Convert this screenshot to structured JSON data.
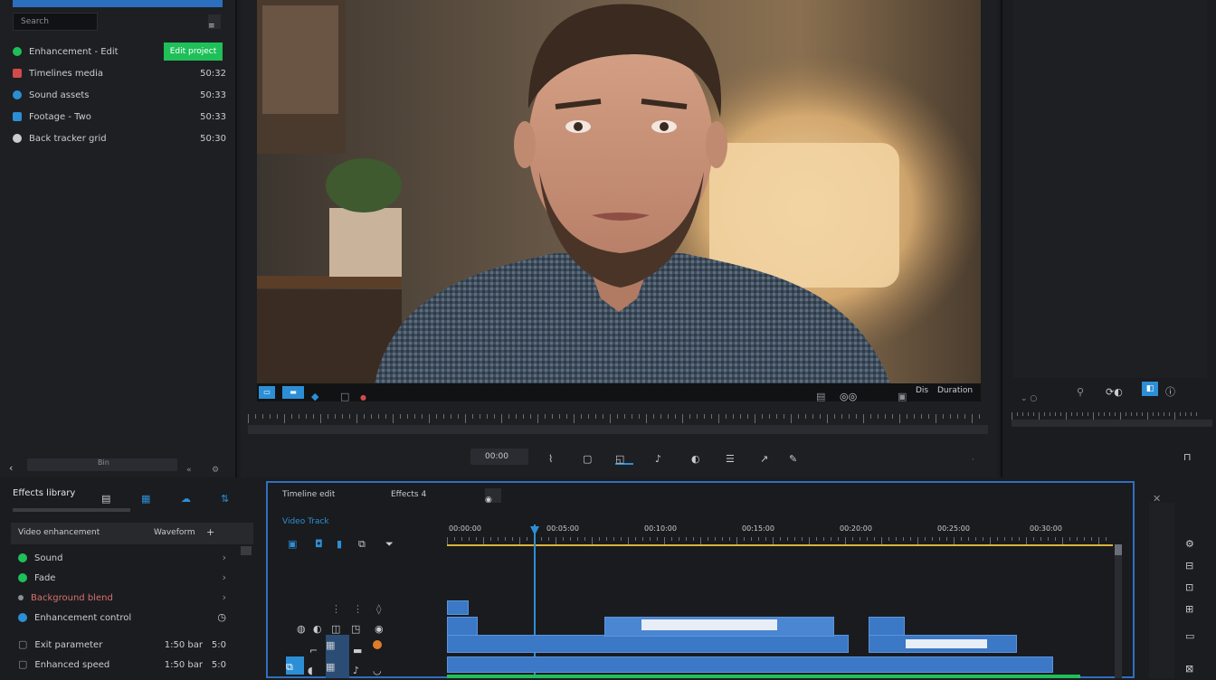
{
  "left_panel": {
    "search_placeholder": "Search",
    "new_bin_button": "Edit project",
    "bins": [
      {
        "name": "Enhancement - Edit",
        "value": "",
        "color": "#1fbf5a",
        "icon": "circle-icon"
      },
      {
        "name": "Timelines media",
        "value": "50:32",
        "color": "#d24a4a",
        "icon": "film-icon"
      },
      {
        "name": "Sound assets",
        "value": "50:33",
        "color": "#2c8fd6",
        "icon": "audio-icon"
      },
      {
        "name": "Footage - Two",
        "value": "50:33",
        "color": "#2c8fd6",
        "icon": "image-icon"
      },
      {
        "name": "Back tracker grid",
        "value": "50:30",
        "color": "#c9ccd2",
        "icon": "person-icon"
      }
    ],
    "footer_label": "Bin"
  },
  "viewer": {
    "timecode_left": "00:00",
    "timecode_right": "Duration",
    "format_label": "Dis",
    "tools": [
      "zoom-fit",
      "trim",
      "crop",
      "transform",
      "audio",
      "color",
      "text",
      "speed",
      "effects"
    ]
  },
  "effects_panel": {
    "title": "Effects library",
    "header_label": "Video enhancement",
    "header_value": "Waveform",
    "items": [
      {
        "label": "Sound",
        "color": "#1fbf5a"
      },
      {
        "label": "Fade",
        "color": "#1fbf5a"
      },
      {
        "label": "Background blend",
        "color": "#c9ccd2"
      },
      {
        "label": "Enhancement control",
        "color": "#2c8fd6"
      },
      {
        "label": "Exit parameter",
        "value": "1:50 bar",
        "extra": "5:0",
        "color": "#c9ccd2"
      },
      {
        "label": "Enhanced speed",
        "value": "1:50 bar",
        "extra": "5:0",
        "color": "#c9ccd2"
      }
    ]
  },
  "timeline": {
    "tab1": "Timeline edit",
    "tab2": "Effects 4",
    "track_title": "Video Track",
    "ruler_labels": [
      "00:00:00",
      "00:05:00",
      "00:10:00",
      "00:15:00",
      "00:20:00",
      "00:25:00",
      "00:30:00"
    ],
    "playhead_color": "#2c8fd6"
  },
  "colors": {
    "accent": "#2c8fd6",
    "green": "#1fbf5a",
    "timeline_border": "#2f6fbf",
    "clip_blue": "#3b78c6",
    "ruler_yellow": "#d8b43a"
  }
}
